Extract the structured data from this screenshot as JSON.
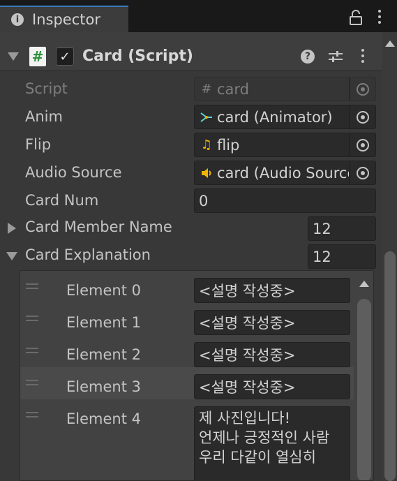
{
  "tab": {
    "title": "Inspector",
    "icon": "info-icon"
  },
  "component": {
    "title": "Card (Script)",
    "enabled": true,
    "icons": [
      "csharp-script-icon",
      "help-icon",
      "presets-icon",
      "more-options-icon"
    ]
  },
  "fields": {
    "script": {
      "label": "Script",
      "value": "card",
      "icon": "#"
    },
    "anim": {
      "label": "Anim",
      "value": "card (Animator)",
      "icon": "animator-icon"
    },
    "flip": {
      "label": "Flip",
      "value": "flip",
      "icon": "audio-clip-icon"
    },
    "audio": {
      "label": "Audio Source",
      "value": "card (Audio Source)",
      "icon": "audio-source-icon"
    },
    "card_num": {
      "label": "Card Num",
      "value": "0"
    },
    "member_name": {
      "label": "Card Member Name",
      "size": "12"
    },
    "explanation": {
      "label": "Card Explanation",
      "size": "12"
    }
  },
  "elements": [
    {
      "label": "Element 0",
      "value": "<설명 작성중>"
    },
    {
      "label": "Element 1",
      "value": "<설명 작성중>"
    },
    {
      "label": "Element 2",
      "value": "<설명 작성중>"
    },
    {
      "label": "Element 3",
      "value": "<설명 작성중>"
    },
    {
      "label": "Element 4",
      "lines": [
        "제 사진입니다!",
        "언제나 긍정적인 사람",
        "우리 다같이 열심히"
      ]
    }
  ],
  "colors": {
    "accent": "#3a79bb",
    "script_icon_green": "#2d8f3a",
    "animator_cyan": "#5fd3d3",
    "audio_yellow": "#f0b400"
  }
}
